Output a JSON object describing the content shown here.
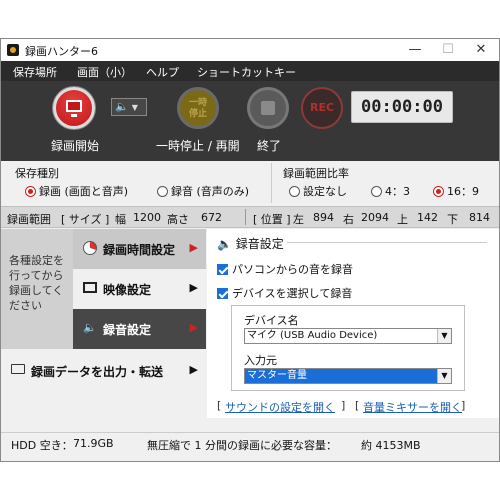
{
  "window": {
    "title": "録画ハンター6",
    "controls": {
      "minimize": "—",
      "maximize": "☐",
      "close": "✕"
    }
  },
  "menu": [
    "保存場所",
    "画面（小）",
    "ヘルプ",
    "ショートカットキー"
  ],
  "toolbar": {
    "record_label": "録画開始",
    "pause_label": "一時停止 / 再開",
    "pause_icon_text": "一時\n停止",
    "stop_label": "終了",
    "rec_badge": "REC",
    "timer": "00:00:00",
    "speaker_icon": "speaker-icon"
  },
  "save_type": {
    "title": "保存種別",
    "options": [
      {
        "label": "録画 (画面と音声)",
        "selected": true
      },
      {
        "label": "録音 (音声のみ)",
        "selected": false
      }
    ]
  },
  "range_ratio": {
    "title": "録画範囲比率",
    "options": [
      {
        "label": "設定なし",
        "selected": false
      },
      {
        "label": "4：3",
        "selected": false
      },
      {
        "label": "16：9",
        "selected": true
      }
    ]
  },
  "range_bar": {
    "label": "録画範囲",
    "size_label": "[ サイズ ]",
    "width_label": "幅",
    "width": "1200",
    "height_label": "高さ",
    "height": "672",
    "pos_label": "[ 位置 ]",
    "left_label": "左",
    "left": "894",
    "right_label": "右",
    "right": "2094",
    "top_label": "上",
    "top": "142",
    "bottom_label": "下",
    "bottom": "814"
  },
  "sidebar": {
    "hint": "各種設定を行ってから録画してください",
    "items": [
      {
        "label": "録画時間設定",
        "icon": "clock-pie-icon"
      },
      {
        "label": "映像設定",
        "icon": "monitor-icon"
      },
      {
        "label": "録音設定",
        "icon": "speaker-icon"
      }
    ],
    "output_label": "録画データを出力・転送",
    "output_icon": "folder-icon"
  },
  "audio_settings": {
    "title": "録音設定",
    "pc_audio_label": "パソコンからの音を録音",
    "pc_audio_checked": true,
    "device_audio_label": "デバイスを選択して録音",
    "device_audio_checked": true,
    "device_name_label": "デバイス名",
    "device_name_value": "マイク (USB Audio Device)",
    "input_label": "入力元",
    "input_value": "マスター音量",
    "sound_settings_link": "サウンドの設定を開く",
    "mixer_link": "音量ミキサーを開く"
  },
  "status": {
    "hdd_label": "HDD 空き：",
    "hdd_value": "71.9GB",
    "estimate_label": "無圧縮で 1 分間の録画に必要な容量：",
    "estimate_value": "約 4153MB"
  },
  "colors": {
    "accent_red": "#d02020",
    "toolbar_bg": "#373737",
    "selection_blue": "#1a6ed8",
    "link_blue": "#1a5fb4"
  }
}
